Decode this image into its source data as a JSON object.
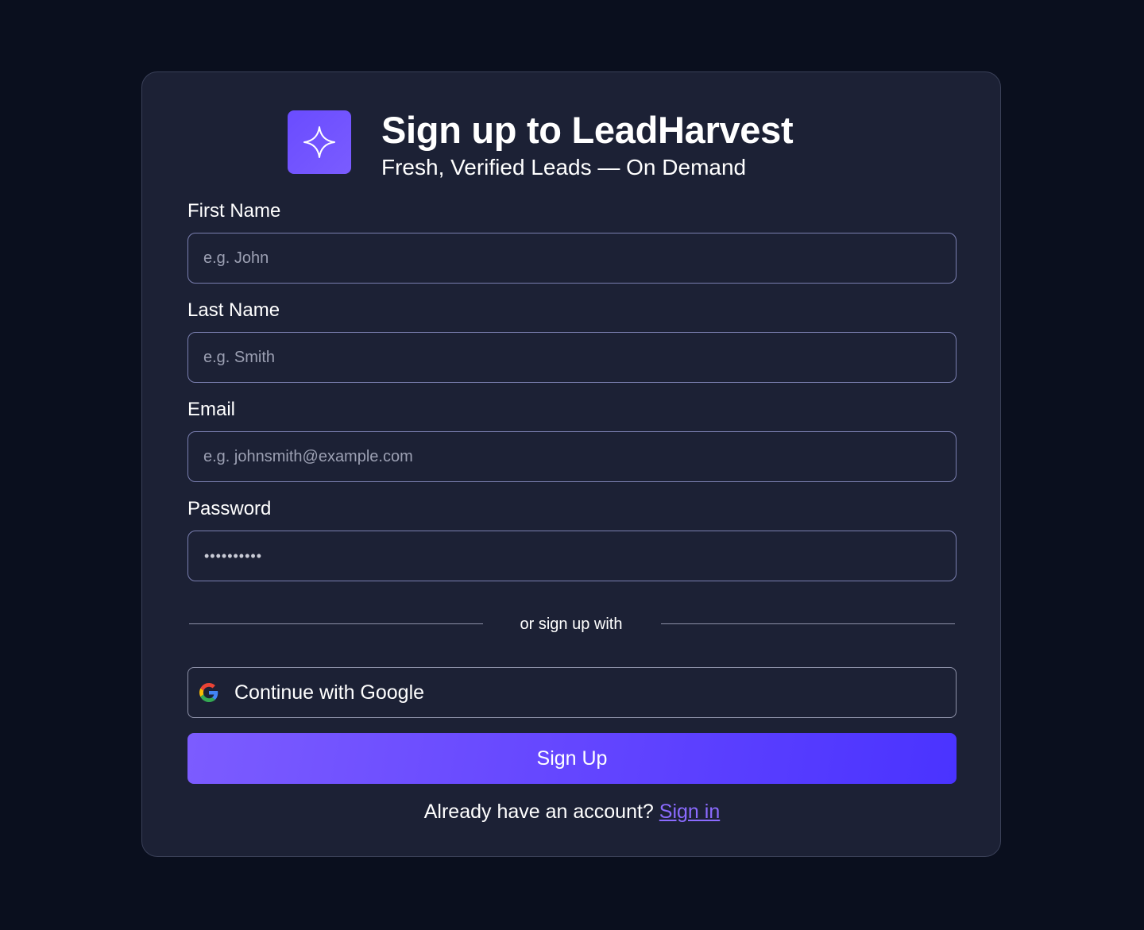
{
  "header": {
    "title": "Sign up to LeadHarvest",
    "subtitle": "Fresh, Verified Leads — On Demand",
    "logo_icon": "sparkle-icon"
  },
  "form": {
    "first_name": {
      "label": "First Name",
      "placeholder": "e.g. John",
      "value": ""
    },
    "last_name": {
      "label": "Last Name",
      "placeholder": "e.g. Smith",
      "value": ""
    },
    "email": {
      "label": "Email",
      "placeholder": "e.g. johnsmith@example.com",
      "value": ""
    },
    "password": {
      "label": "Password",
      "masked_value": "••••••••••"
    }
  },
  "divider_text": "or sign up with",
  "google_button": {
    "label": "Continue with Google",
    "icon": "google-icon"
  },
  "signup_button": {
    "label": "Sign Up"
  },
  "footer": {
    "prompt": "Already have an account?",
    "link": "Sign in"
  },
  "colors": {
    "background": "#0a0f1e",
    "card": "#1c2135",
    "accent": "#6a4cff",
    "link": "#8b6bff"
  }
}
